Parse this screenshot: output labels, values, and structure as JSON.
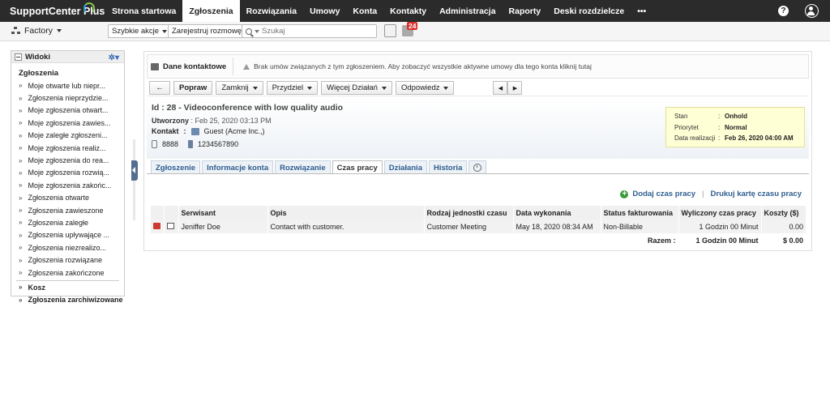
{
  "app": {
    "logo": "SupportCenter Plus"
  },
  "nav": {
    "tabs": [
      {
        "label": "Strona startowa"
      },
      {
        "label": "Zgłoszenia",
        "active": true
      },
      {
        "label": "Rozwiązania"
      },
      {
        "label": "Umowy"
      },
      {
        "label": "Konta"
      },
      {
        "label": "Kontakty"
      },
      {
        "label": "Administracja"
      },
      {
        "label": "Raporty"
      },
      {
        "label": "Deski rozdzielcze"
      }
    ],
    "more": "•••",
    "help": "?"
  },
  "toolbar": {
    "site": "Factory",
    "quick_actions": "Szybkie akcje",
    "log_call": "Zarejestruj rozmowę",
    "search_placeholder": "Szukaj",
    "notif_count": "24"
  },
  "sidebar": {
    "title": "Widoki",
    "section": "Zgłoszenia",
    "items": [
      "Moje otwarte lub niepr...",
      "Zgłoszenia nieprzydzie...",
      "Moje zgłoszenia otwart...",
      "Moje zgłoszenia zawies...",
      "Moje zaległe zgłoszeni...",
      "Moje zgłoszenia realiz...",
      "Moje zgłoszenia do rea...",
      "Moje zgłoszenia rozwią...",
      "Moje zgłoszenia zakońc...",
      "Zgłoszenia otwarte",
      "Zgłoszenia zawieszone",
      "Zgłoszenia zaległe",
      "Zgłoszenia upływające ...",
      "Zgłoszenia niezrealizo...",
      "Zgłoszenia rozwiązane",
      "Zgłoszenia zakończone"
    ],
    "bottom_items": [
      "Kosz",
      "Zgłoszenia zarchiwizowane"
    ]
  },
  "contact_bar": {
    "label": "Dane kontaktowe",
    "message": "Brak umów związanych z tym zgłoszeniem. Aby zobaczyć wszystkie aktywne umowy dla tego konta",
    "link": "kliknij tutaj"
  },
  "actions": {
    "back": "←",
    "edit": "Popraw",
    "close": "Zamknij",
    "assign": "Przydziel",
    "more": "Więcej Działań",
    "reply": "Odpowiedz",
    "prev": "◀",
    "next": "▶"
  },
  "request": {
    "title": "Id : 28 - Videoconference with low quality audio",
    "created_label": "Utworzony",
    "created_value": ": Feb 25, 2020 03:13 PM",
    "contact_label": "Kontakt",
    "contact_sep": ":",
    "contact_value": "Guest (Acme Inc.,)",
    "phone": "8888",
    "mobile": "1234567890"
  },
  "status_box": {
    "rows": [
      {
        "k": "Stan",
        "v": "Onhold"
      },
      {
        "k": "Priorytet",
        "v": "Normal"
      },
      {
        "k": "Data realizacji",
        "v": "Feb 26, 2020 04:00 AM"
      }
    ]
  },
  "tabs": [
    "Zgłoszenie",
    "Informacje konta",
    "Rozwiązanie",
    "Czas pracy",
    "Działania",
    "Historia"
  ],
  "worklog": {
    "add_link": "Dodaj czas pracy",
    "print_link": "Drukuj kartę czasu pracy",
    "columns": [
      "Serwisant",
      "Opis",
      "Rodzaj jednostki czasu",
      "Data wykonania",
      "Status fakturowania",
      "Wyliczony czas pracy",
      "Koszty ($)"
    ],
    "row": {
      "technician": "Jeniffer Doe",
      "desc": "Contact with customer.",
      "unit": "Customer Meeting",
      "date": "May 18, 2020 08:34 AM",
      "billing": "Non-Billable",
      "time": "1 Godzin 00 Minut",
      "cost": "0.00"
    },
    "total": {
      "label": "Razem :",
      "time": "1 Godzin 00 Minut",
      "cost": "$ 0.00"
    }
  },
  "colors": {
    "nav_bg": "#2b2b2b",
    "link": "#2f5d8f",
    "status_bg": "#ffffd6"
  }
}
